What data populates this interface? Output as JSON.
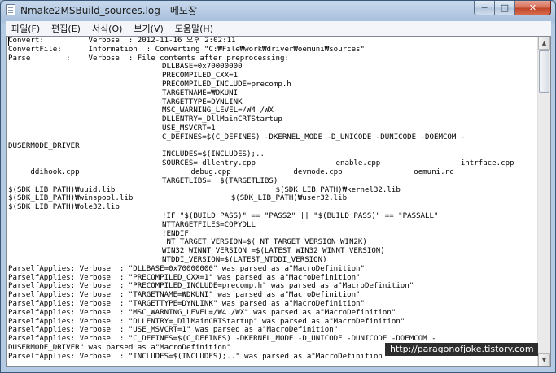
{
  "window": {
    "title": "Nmake2MSBuild_sources.log - 메모장",
    "minimize_glyph": "─",
    "maximize_glyph": "□",
    "close_glyph": "✕",
    "icon": "notepad-icon"
  },
  "menu": [
    {
      "label": "파일(F)"
    },
    {
      "label": "편집(E)"
    },
    {
      "label": "서식(O)"
    },
    {
      "label": "보기(V)"
    },
    {
      "label": "도움말(H)"
    }
  ],
  "scrollbar": {
    "up_glyph": "▲",
    "down_glyph": "▼"
  },
  "watermark": "http://paragonofjoke.tistory.com",
  "content": {
    "lines": [
      {
        "text": "Convert:          Verbose  : 2012-11-16 오후 2:02:11",
        "col": 0
      },
      {
        "text": "ConvertFile:      Information  : Converting \"C:₩File₩work₩driver₩oemuni₩sources\"",
        "col": 0
      },
      {
        "text": "Parse        :    Verbose  : File contents after preprocessing:",
        "col": 0
      },
      {
        "text": "DLLBASE=0x70000000",
        "col": 189
      },
      {
        "text": "PRECOMPILED_CXX=1",
        "col": 189
      },
      {
        "text": "PRECOMPILED_INCLUDE=precomp.h",
        "col": 189
      },
      {
        "text": "TARGETNAME=₩DKUNI",
        "col": 189
      },
      {
        "text": "TARGETTYPE=DYNLINK",
        "col": 189
      },
      {
        "text": "MSC_WARNING_LEVEL=/W4 /WX",
        "col": 189
      },
      {
        "text": "DLLENTRY=_DllMainCRTStartup",
        "col": 189
      },
      {
        "text": "USE_MSVCRT=1",
        "col": 189
      },
      {
        "text": "C_DEFINES=$(C_DEFINES) -DKERNEL_MODE -D_UNICODE -DUNICODE -DOEMCOM -",
        "col": 189
      },
      {
        "text": "DUSERMODE_DRIVER",
        "col": 0
      },
      {
        "text": "INCLUDES=$(INCLUDES);..",
        "col": 189
      },
      {
        "text": "SOURCES= dllentry.cpp                  enable.cpp                  intrface.cpp",
        "col": 189
      },
      {
        "text": "     ddihook.cpp                         debug.cpp              devmode.cpp                oemuni.rc",
        "col": 0
      },
      {
        "text": "TARGETLIBS=  $(TARGETLIBS)",
        "col": 189
      },
      {
        "text": "$(SDK_LIB_PATH)₩uuid.lib                                    $(SDK_LIB_PATH)₩kernel32.lib",
        "col": 0
      },
      {
        "text": "$(SDK_LIB_PATH)₩winspool.lib                      $(SDK_LIB_PATH)₩user32.lib",
        "col": 0
      },
      {
        "text": "$(SDK_LIB_PATH)₩ole32.lib",
        "col": 0
      },
      {
        "text": "!IF \"$(BUILD_PASS)\" == \"PASS2\" || \"$(BUILD_PASS)\" == \"PASSALL\"",
        "col": 189
      },
      {
        "text": "NTTARGETFILES=COPYDLL",
        "col": 189
      },
      {
        "text": "!ENDIF",
        "col": 189
      },
      {
        "text": "_NT_TARGET_VERSION=$(_NT_TARGET_VERSION_WIN2K)",
        "col": 189
      },
      {
        "text": "WIN32_WINNT_VERSION =$(LATEST_WIN32_WINNT_VERSION)",
        "col": 189
      },
      {
        "text": "NTDDI_VERSION=$(LATEST_NTDDI_VERSION)",
        "col": 189
      },
      {
        "text": "ParselfApplies: Verbose  : \"DLLBASE=0x70000000\" was parsed as a\"MacroDefinition\"",
        "col": 0
      },
      {
        "text": "ParselfApplies: Verbose  : \"PRECOMPILED_CXX=1\" was parsed as a\"MacroDefinition\"",
        "col": 0
      },
      {
        "text": "ParselfApplies: Verbose  : \"PRECOMPILED_INCLUDE=precomp.h\" was parsed as a\"MacroDefinition\"",
        "col": 0
      },
      {
        "text": "ParselfApplies: Verbose  : \"TARGETNAME=₩DKUNI\" was parsed as a\"MacroDefinition\"",
        "col": 0
      },
      {
        "text": "ParselfApplies: Verbose  : \"TARGETTYPE=DYNLINK\" was parsed as a\"MacroDefinition\"",
        "col": 0
      },
      {
        "text": "ParselfApplies: Verbose  : \"MSC_WARNING_LEVEL=/W4 /WX\" was parsed as a\"MacroDefinition\"",
        "col": 0
      },
      {
        "text": "ParselfApplies: Verbose  : \"DLLENTRY=_DllMainCRTStartup\" was parsed as a\"MacroDefinition\"",
        "col": 0
      },
      {
        "text": "ParselfApplies: Verbose  : \"USE_MSVCRT=1\" was parsed as a\"MacroDefinition\"",
        "col": 0
      },
      {
        "text": "ParselfApplies: Verbose  : \"C_DEFINES=$(C_DEFINES) -DKERNEL_MODE -D_UNICODE -DUNICODE -DOEMCOM -",
        "col": 0
      },
      {
        "text": "DUSERMODE_DRIVER\" was parsed as a\"MacroDefinition\"",
        "col": 0
      },
      {
        "text": "ParselfApplies: Verbose  : \"INCLUDES=$(INCLUDES);..\" was parsed as a\"MacroDefinition",
        "col": 0
      }
    ]
  }
}
